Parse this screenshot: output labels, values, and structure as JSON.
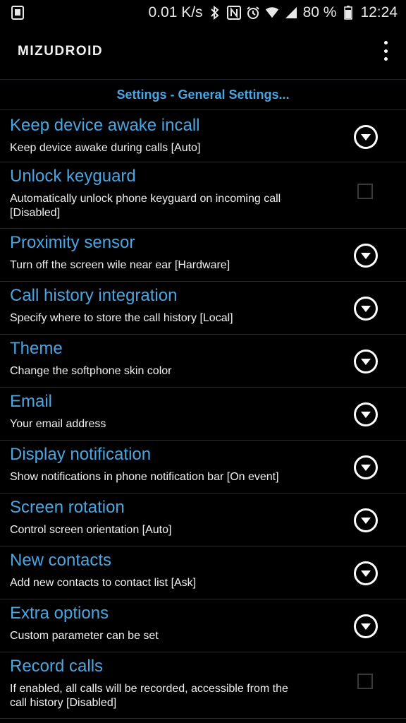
{
  "status_bar": {
    "net_speed": "0.01 K/s",
    "battery": "80 %",
    "time": "12:24"
  },
  "app": {
    "logo_text": "MIZUDROID",
    "header": "Settings - General Settings..."
  },
  "settings": [
    {
      "title": "Keep device awake incall",
      "desc": "Keep device awake during calls [Auto]",
      "control": "dropdown"
    },
    {
      "title": "Unlock keyguard",
      "desc": "Automatically unlock phone keyguard on incoming call [Disabled]",
      "control": "checkbox"
    },
    {
      "title": "Proximity sensor",
      "desc": "Turn off the screen wile near ear [Hardware]",
      "control": "dropdown"
    },
    {
      "title": "Call history integration",
      "desc": "Specify where to store the call history [Local]",
      "control": "dropdown"
    },
    {
      "title": "Theme",
      "desc": "Change the softphone skin color",
      "control": "dropdown"
    },
    {
      "title": "Email",
      "desc": "Your email address",
      "control": "dropdown"
    },
    {
      "title": "Display notification",
      "desc": "Show notifications in phone notification bar [On event]",
      "control": "dropdown"
    },
    {
      "title": "Screen rotation",
      "desc": "Control screen orientation [Auto]",
      "control": "dropdown"
    },
    {
      "title": "New contacts",
      "desc": "Add new contacts to contact list [Ask]",
      "control": "dropdown"
    },
    {
      "title": "Extra options",
      "desc": "Custom parameter can be set",
      "control": "dropdown"
    },
    {
      "title": "Record calls",
      "desc": "If enabled, all calls will be recorded, accessible from the call history [Disabled]",
      "control": "checkbox"
    }
  ],
  "colors": {
    "accent": "#4aa6e3",
    "background": "#000000",
    "divider": "#2c2c2c"
  },
  "icons": {
    "status_left": "sim-card-icon",
    "status_right": [
      "bluetooth-icon",
      "nfc-icon",
      "alarm-icon",
      "wifi-icon",
      "signal-icon",
      "battery-icon"
    ],
    "overflow": "overflow-menu-icon",
    "dropdown": "chevron-down-circle-icon"
  }
}
